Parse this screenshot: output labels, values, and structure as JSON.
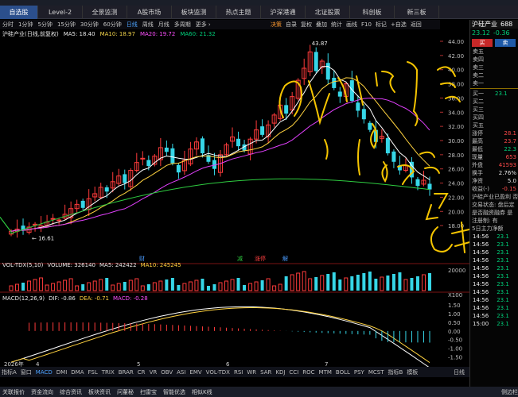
{
  "nav": {
    "tabs": [
      "自选股",
      "Level-2",
      "全景监测",
      "A股市场",
      "板块监测",
      "热点主题",
      "沪深港通",
      "北证股票",
      "科创板",
      "新三板"
    ],
    "active": 0
  },
  "periods": [
    "分时",
    "1分钟",
    "5分钟",
    "15分钟",
    "30分钟",
    "60分钟",
    "日线",
    "周线",
    "月线",
    "多周期",
    "更多 ›"
  ],
  "active_period": "日线",
  "tools": [
    "决策",
    "自录",
    "复权",
    "叠加",
    "统计",
    "画线",
    "F10",
    "标记",
    "+自选",
    "返回"
  ],
  "stock_info": {
    "name_line": "沪硅产业(日线,前复权)",
    "ma5": "MA5: 18.40",
    "ma10": "MA10: 18.97",
    "ma20": "MA20: 19.72",
    "ma60": "MA60: 21.32"
  },
  "price_axis": [
    "44.00",
    "42.00",
    "40.00",
    "38.00",
    "36.00",
    "34.00",
    "32.00",
    "30.00",
    "28.00",
    "26.00",
    "24.00",
    "22.00",
    "20.00",
    "18.00"
  ],
  "high_label": "43.87",
  "low_label": "16.61",
  "volume_info": {
    "name": "VOL-TDX(5,10)",
    "volume": "VOLUME: 326140",
    "ma5": "MA5: 242422",
    "ma10": "MA10: 245245",
    "axis_top": "20000",
    "axis_unit": "X100"
  },
  "macd_info": {
    "name": "MACD(12,26,9)",
    "dif": "DIF: -0.86",
    "dea": "DEA: -0.71",
    "macd": "MACD: -0.28",
    "axis": [
      "1.50",
      "1.00",
      "0.50",
      "0.00",
      "-0.50",
      "-1.00",
      "-1.50"
    ]
  },
  "event_markers": [
    "财",
    "减",
    "涨停",
    "解"
  ],
  "date_axis": [
    "2026年",
    "4",
    "5",
    "6",
    "7"
  ],
  "bottom_tabs": [
    "指标A",
    "窗口",
    "MACD",
    "DMI",
    "DMA",
    "FSL",
    "TRIX",
    "BRAR",
    "CR",
    "VR",
    "OBV",
    "ASI",
    "EMV",
    "VOL-TDX",
    "RSI",
    "WR",
    "SAR",
    "KDJ",
    "CCI",
    "ROC",
    "MTM",
    "BOLL",
    "PSY",
    "MCST",
    "指标B",
    "模板"
  ],
  "bottom_right": "日线",
  "status_bar": [
    "关联报价",
    "资金流向",
    "综合资讯",
    "板块资讯",
    "问董秘",
    "扫雷宝",
    "智能优选",
    "相似K线",
    "侧边栏"
  ],
  "right_panel": {
    "title": "沪硅产业",
    "code": "688",
    "price": "23.12",
    "change": "-0.36",
    "buy_label": "买",
    "sell_label": "卖",
    "asks": [
      "卖五",
      "卖四",
      "卖三",
      "卖二",
      "卖一"
    ],
    "bids": [
      "买一",
      "买二",
      "买三",
      "买四",
      "买五"
    ],
    "ask_bid_price": "23.1",
    "stats": [
      {
        "label": "涨停",
        "value": "28.1"
      },
      {
        "label": "最高",
        "value": "23.7"
      },
      {
        "label": "最低",
        "value": "22.3"
      },
      {
        "label": "现量",
        "value": "653"
      },
      {
        "label": "外盘",
        "value": "41593"
      },
      {
        "label": "换手",
        "value": "2.76%"
      },
      {
        "label": "净资",
        "value": "5.0"
      },
      {
        "label": "收益(-)",
        "value": "-0.15"
      }
    ],
    "notes": [
      "沪硅产业已盈利 否",
      "交易状态: 盘后定",
      "是否融资融券 是",
      "注册制: 有",
      "5日主力净额"
    ],
    "ticks": [
      {
        "time": "14:56",
        "price": "23.1"
      },
      {
        "time": "14:56",
        "price": "23.1"
      },
      {
        "time": "14:56",
        "price": "23.1"
      },
      {
        "time": "14:56",
        "price": "23.1"
      },
      {
        "time": "14:56",
        "price": "23.1"
      },
      {
        "time": "14:56",
        "price": "23.1"
      },
      {
        "time": "14:56",
        "price": "23.1"
      },
      {
        "time": "14:56",
        "price": "23.1"
      },
      {
        "time": "14:56",
        "price": "23.1"
      },
      {
        "time": "14:56",
        "price": "23.1"
      },
      {
        "time": "14:56",
        "price": "23.1"
      },
      {
        "time": "15:00",
        "price": "23.1"
      }
    ]
  },
  "colors": {
    "up": "#ff3b3b",
    "down": "#36d6e7",
    "ma5": "#ffffff",
    "ma10": "#ffd23f",
    "ma20": "#e040fb",
    "ma60": "#2ecc40",
    "annotation": "#f5c400"
  },
  "chart_data": {
    "type": "candlestick",
    "close_path": [
      17.2,
      17.5,
      17.3,
      17.8,
      18.2,
      18.0,
      18.5,
      19.0,
      18.8,
      19.6,
      20.4,
      21.0,
      20.5,
      21.8,
      22.5,
      23.4,
      22.8,
      24.2,
      25.0,
      24.0,
      25.8,
      26.9,
      27.5,
      26.4,
      27.8,
      29.0,
      28.4,
      26.8,
      25.5,
      27.2,
      28.8,
      29.8,
      28.2,
      27.0,
      26.0,
      28.0,
      29.4,
      30.5,
      29.2,
      28.6,
      30.2,
      31.5,
      30.8,
      32.2,
      33.6,
      35.0,
      33.8,
      36.2,
      38.5,
      40.2,
      42.5,
      39.8,
      41.2,
      38.6,
      37.4,
      36.2,
      38.0,
      35.6,
      34.2,
      33.0,
      31.5,
      29.8,
      30.6,
      28.2,
      27.0,
      25.8,
      26.5,
      24.8,
      23.6,
      24.4,
      23.1
    ]
  }
}
